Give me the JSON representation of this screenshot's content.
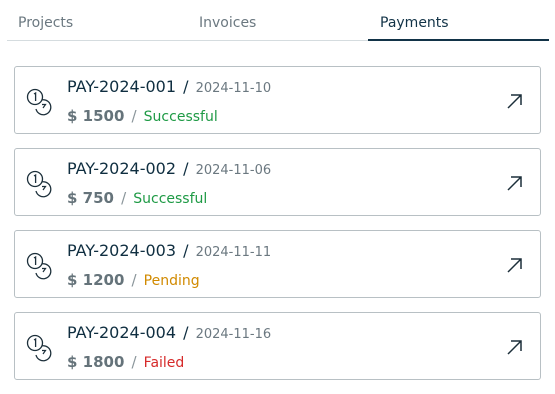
{
  "tabs": [
    {
      "label": "Projects",
      "active": false
    },
    {
      "label": "Invoices",
      "active": false
    },
    {
      "label": "Payments",
      "active": true
    }
  ],
  "payments": [
    {
      "id": "PAY-2024-001",
      "separator": "/",
      "date": "2024-11-10",
      "amount": "$ 1500",
      "status": "Successful",
      "status_color": "#1e9a45",
      "icon": "coins-icon",
      "action_icon": "external-link-arrow-icon"
    },
    {
      "id": "PAY-2024-002",
      "separator": "/",
      "date": "2024-11-06",
      "amount": "$ 750",
      "status": "Successful",
      "status_color": "#1e9a45",
      "icon": "coins-icon",
      "action_icon": "external-link-arrow-icon"
    },
    {
      "id": "PAY-2024-003",
      "separator": "/",
      "date": "2024-11-11",
      "amount": "$ 1200",
      "status": "Pending",
      "status_color": "#d18a00",
      "icon": "coins-icon",
      "action_icon": "external-link-arrow-icon"
    },
    {
      "id": "PAY-2024-004",
      "separator": "/",
      "date": "2024-11-16",
      "amount": "$ 1800",
      "status": "Failed",
      "status_color": "#d62a2a",
      "icon": "coins-icon",
      "action_icon": "external-link-arrow-icon"
    }
  ],
  "colors": {
    "active_tab": "#123347",
    "text_dark": "#0f2e40",
    "muted": "#6b7880",
    "border": "#b8c0c4"
  }
}
